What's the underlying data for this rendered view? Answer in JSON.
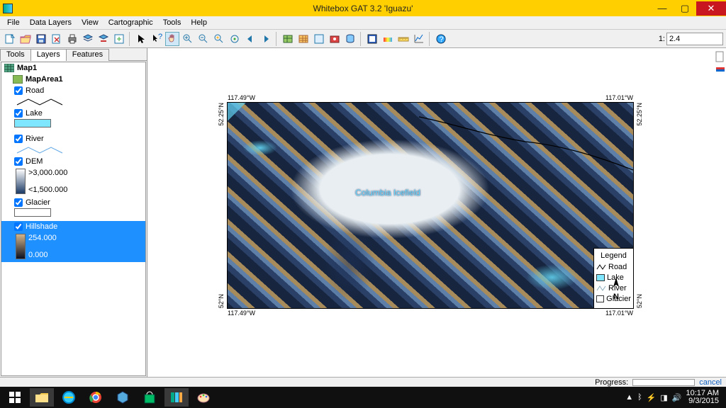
{
  "titlebar": {
    "title": "Whitebox GAT 3.2 'Iguazu'"
  },
  "menu": {
    "items": [
      "File",
      "Data Layers",
      "View",
      "Cartographic",
      "Tools",
      "Help"
    ]
  },
  "toolbar": {
    "scale_prefix": "1:",
    "scale_value": "2.4",
    "icons": [
      "new-map",
      "open",
      "save",
      "print",
      "layer-mgr",
      "add-vector",
      "add-raster",
      "new-layer",
      "select-tool",
      "identify",
      "help-cursor",
      "pan",
      "zoom-in",
      "zoom-out",
      "zoom-extent",
      "zoom-layer",
      "prev-extent",
      "next-extent",
      "attr-table",
      "raster-calc",
      "img-histogram",
      "screenshot",
      "db",
      "wb-settings",
      "palette",
      "measure",
      "graph",
      "help"
    ]
  },
  "panel_tabs": [
    "Tools",
    "Layers",
    "Features"
  ],
  "active_panel_tab": "Layers",
  "tree": {
    "map": "Map1",
    "area": "MapArea1",
    "layers": [
      {
        "name": "Road",
        "checked": true,
        "type": "line",
        "color": "#000000"
      },
      {
        "name": "Lake",
        "checked": true,
        "type": "fill",
        "color": "#7fe6ff"
      },
      {
        "name": "River",
        "checked": true,
        "type": "line",
        "color": "#4aa3ff"
      },
      {
        "name": "DEM",
        "checked": true,
        "type": "ramp",
        "max": ">3,000.000",
        "min": "<1,500.000"
      },
      {
        "name": "Glacier",
        "checked": true,
        "type": "fill",
        "color": "#ffffff"
      },
      {
        "name": "Hillshade",
        "checked": true,
        "type": "ramp",
        "max": "254.000",
        "min": "0.000",
        "selected": true
      }
    ]
  },
  "map": {
    "label": "Columbia Icefield",
    "nw_lon": "117.49°W",
    "ne_lon": "117.01°W",
    "nw_lat": "52.25°N",
    "sw_lat": "52°N",
    "legend_title": "Legend",
    "legend_items": [
      {
        "label": "Road",
        "type": "line",
        "color": "#000"
      },
      {
        "label": "Lake",
        "type": "fill",
        "color": "#7fe6ff"
      },
      {
        "label": "River",
        "type": "line",
        "color": "#7faadd"
      },
      {
        "label": "Glacier",
        "type": "fill",
        "color": "#ffffff"
      }
    ],
    "north": "N"
  },
  "status": {
    "progress_label": "Progress:",
    "cancel": "cancel"
  },
  "taskbar": {
    "time": "10:17 AM",
    "date": "9/3/2015"
  }
}
